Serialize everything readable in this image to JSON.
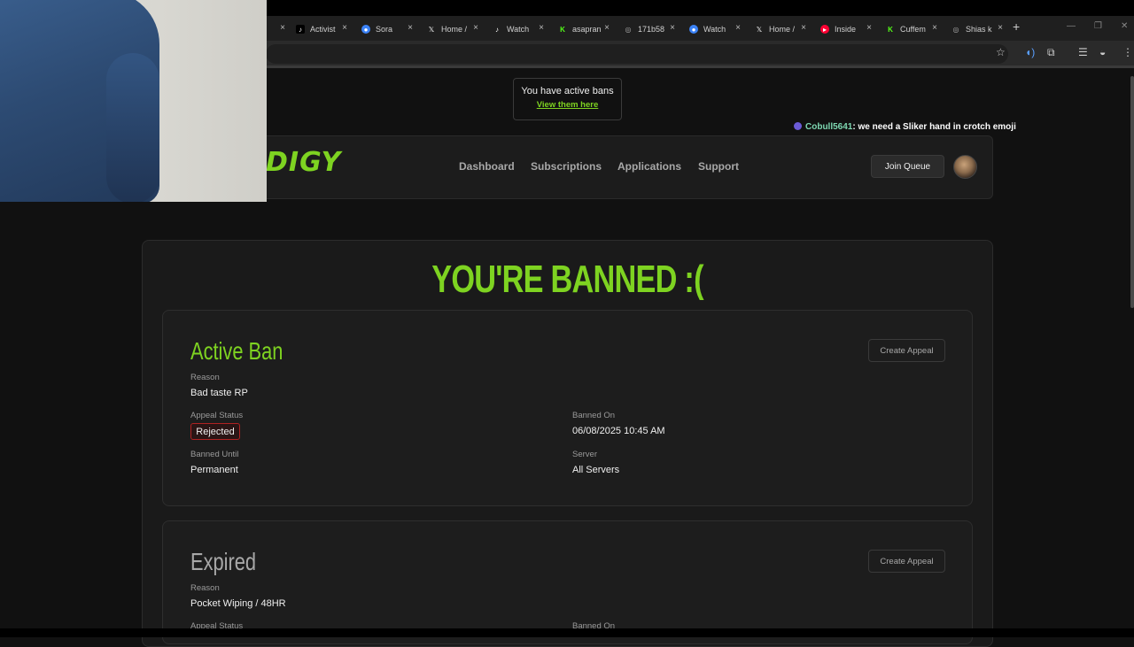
{
  "browser": {
    "tabs": [
      {
        "title": "",
        "icon": "blank-icon",
        "color": "#555555"
      },
      {
        "title": "Activist",
        "icon": "tiktok-icon",
        "color": "#000000"
      },
      {
        "title": "Sora",
        "icon": "sora-icon",
        "color": "#3b82f6"
      },
      {
        "title": "Home /",
        "icon": "x-icon",
        "color": "#000000"
      },
      {
        "title": "Watch",
        "icon": "tiktok-icon",
        "color": "#000000"
      },
      {
        "title": "asapran",
        "icon": "kick-icon",
        "color": "#53fc18"
      },
      {
        "title": "171b58",
        "icon": "globe-icon",
        "color": "#777777"
      },
      {
        "title": "Watch",
        "icon": "sora-icon",
        "color": "#3b82f6"
      },
      {
        "title": "Home /",
        "icon": "x-icon",
        "color": "#000000"
      },
      {
        "title": "Inside",
        "icon": "youtube-icon",
        "color": "#ff0033"
      },
      {
        "title": "Cuffem",
        "icon": "kick-icon",
        "color": "#53fc18"
      },
      {
        "title": "Shias k",
        "icon": "globe-icon",
        "color": "#777777"
      }
    ],
    "new_tab": "+",
    "close_glyph": "×"
  },
  "notice": {
    "title": "You have active bans",
    "link": "View them here"
  },
  "chat": {
    "user": "Cobull5641",
    "message": ": we need a Sliker hand in crotch emoji"
  },
  "nav": {
    "logo": "DIGY",
    "links": [
      "Dashboard",
      "Subscriptions",
      "Applications",
      "Support"
    ],
    "join_queue": "Join Queue"
  },
  "main": {
    "title": "YOU'RE BANNED :(",
    "bans": [
      {
        "status_title": "Active Ban",
        "status_color": "#7ed321",
        "appeal_button": "Create Appeal",
        "reason_label": "Reason",
        "reason": "Bad taste RP",
        "appeal_status_label": "Appeal Status",
        "appeal_status": "Rejected",
        "banned_on_label": "Banned On",
        "banned_on": "06/08/2025 10:45 AM",
        "banned_until_label": "Banned Until",
        "banned_until": "Permanent",
        "server_label": "Server",
        "server": "All Servers"
      },
      {
        "status_title": "Expired",
        "status_color": "#a8a8a8",
        "appeal_button": "Create Appeal",
        "reason_label": "Reason",
        "reason": "Pocket Wiping / 48HR",
        "appeal_status_label": "Appeal Status",
        "banned_on_label": "Banned On"
      }
    ]
  },
  "colors": {
    "accent": "#7ed321",
    "background": "#111111",
    "danger": "#b02222"
  }
}
